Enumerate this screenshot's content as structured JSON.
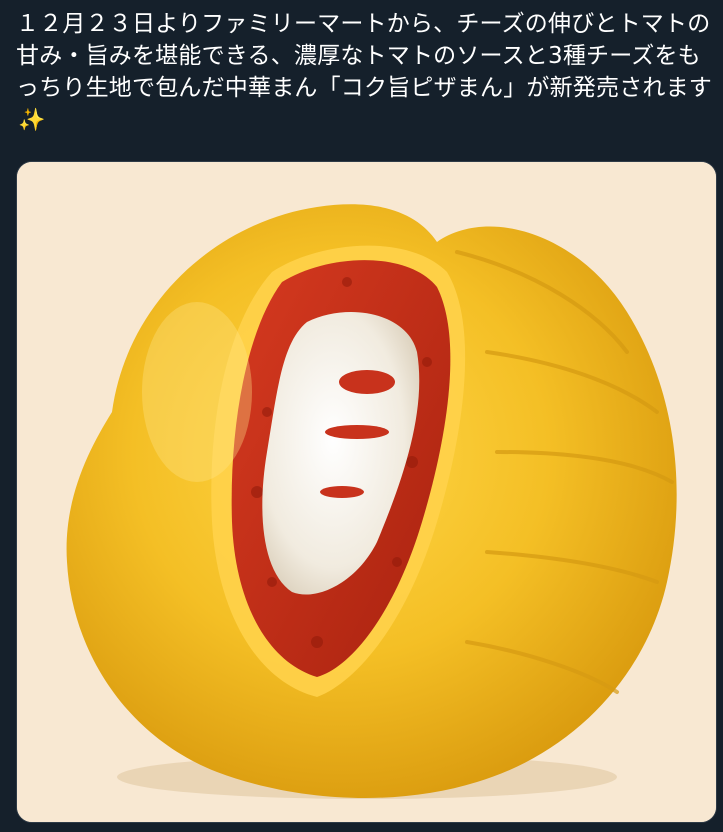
{
  "tweet": {
    "text": "１２月２３日よりファミリーマートから、チーズの伸びとトマトの甘み・旨みを堪能できる、濃厚なトマトのソースと3種チーズをもっちり生地で包んだ中華まん「コク旨ピザまん」が新発売されます",
    "emoji_icon": "sparkles-icon",
    "emoji_glyph": "✨"
  },
  "media": {
    "background_color": "#f8e8d2",
    "bun_color": "#f5c22a",
    "sauce_color": "#c8321c",
    "cheese_color": "#f4efe4"
  }
}
